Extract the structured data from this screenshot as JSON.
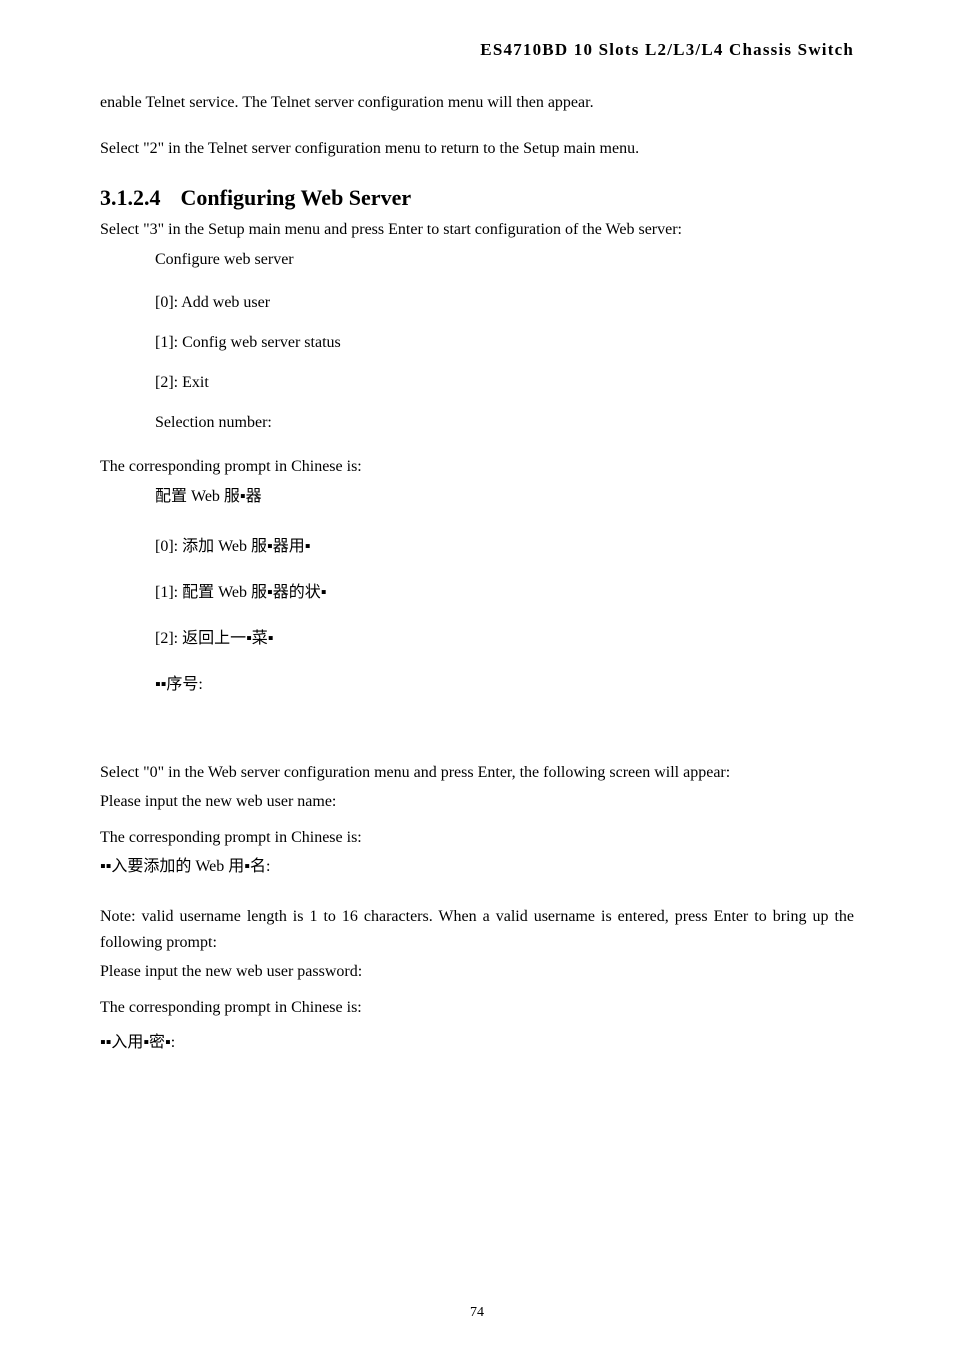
{
  "header": {
    "title": "ES4710BD 10 Slots L2/L3/L4 Chassis Switch"
  },
  "intro": {
    "line1": "enable Telnet service. The Telnet server configuration menu will then appear.",
    "line2": "Select \"2\" in the Telnet server configuration menu to return to the Setup main menu."
  },
  "section": {
    "number": "3.1.2.4",
    "title": "Configuring Web Server",
    "desc": "Select \"3\" in the Setup main menu and press Enter to start configuration of the Web server:"
  },
  "menu_en": {
    "title": "Configure web server",
    "items": [
      "[0]: Add web user",
      "[1]: Config web server status",
      "[2]: Exit"
    ],
    "prompt": "Selection number:"
  },
  "chinese_intro": "The corresponding prompt in Chinese is:",
  "menu_cn": {
    "title": "配置 Web 服▪器",
    "items": [
      "[0]: 添加 Web 服▪器用▪",
      "[1]: 配置 Web 服▪器的状▪",
      "[2]: 返回上一▪菜▪"
    ],
    "prompt": "▪▪序号:"
  },
  "select0": {
    "desc": "Select \"0\" in the Web server configuration menu and press Enter, the following screen will appear:",
    "prompt_en": "Please input the new web user name:",
    "prompt_cn_intro": "The corresponding prompt in Chinese is:",
    "prompt_cn": "▪▪入要添加的 Web 用▪名:"
  },
  "note": {
    "desc": "Note: valid username length is 1 to 16 characters. When a valid username is entered, press Enter to bring up the following prompt:",
    "prompt_en": "Please input the new web user password:",
    "prompt_cn_intro": "The corresponding prompt in Chinese is:",
    "prompt_cn": "▪▪入用▪密▪:"
  },
  "page_number": "74"
}
